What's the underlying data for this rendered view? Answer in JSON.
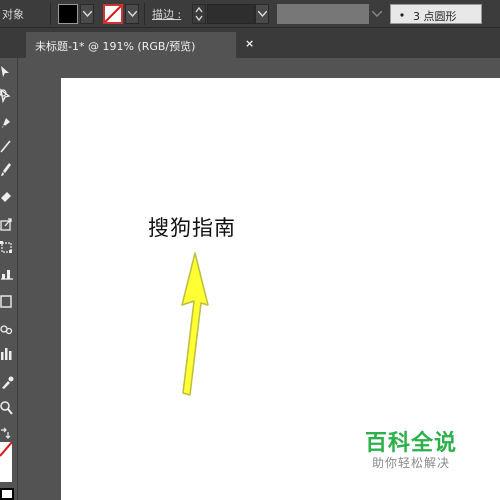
{
  "control_bar": {
    "object_label": "对象",
    "fill_color": "#000000",
    "stroke_color": "#cc3333",
    "stroke_label": "描边 :",
    "stroke_weight_value": "",
    "brush_definition": "3 点圆形"
  },
  "document_tab": {
    "title": "未标题-1* @ 191% (RGB/预览)",
    "close_glyph": "×"
  },
  "tools": [
    "selection",
    "direct-selection",
    "pen",
    "line",
    "paintbrush",
    "eraser",
    "scale",
    "free-transform",
    "column-graph-area",
    "rectangle",
    "symbol-sprayer",
    "column-graph",
    "eyedropper",
    "zoom",
    "swap-fill-stroke"
  ],
  "artboard": {
    "text": "搜狗指南",
    "arrow_color": "#ffff33"
  },
  "watermark": {
    "title": "百科全说",
    "subtitle": "助你轻松解决",
    "title_color": "#2cb04a"
  }
}
